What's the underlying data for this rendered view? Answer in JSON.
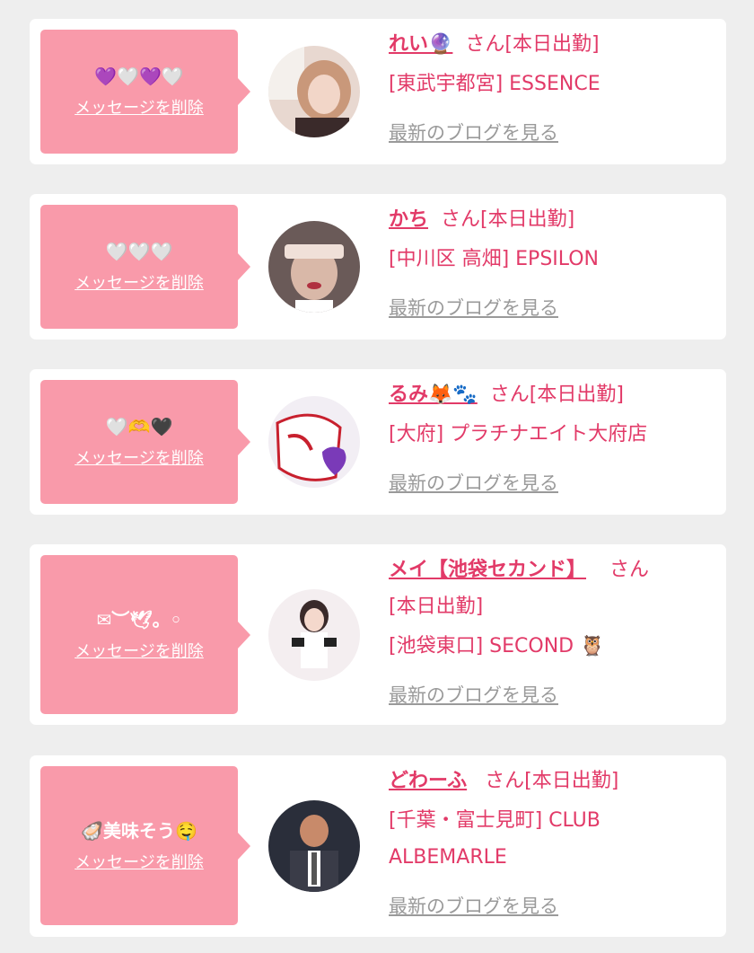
{
  "delete_label": "メッセージを削除",
  "blog_label": "最新のブログを見る",
  "colors": {
    "accent": "#e23a68",
    "bubble": "#f99aaa",
    "background": "#eeeeee"
  },
  "cards": [
    {
      "message": "💜🤍💜🤍",
      "name": "れい🔮",
      "suffix": "さん[本日出勤]",
      "shop": "[東武宇都宮] ESSENCE"
    },
    {
      "message": "🤍🤍🤍",
      "name": "かち",
      "suffix": "さん[本日出勤]",
      "shop": "[中川区 高畑] EPSILON"
    },
    {
      "message": "🤍🫶🖤",
      "name": "るみ🦊🐾",
      "suffix": "さん[本日出勤]",
      "shop": "[大府] プラチナエイト大府店"
    },
    {
      "message": "✉︎︶🕊。◦",
      "name": "メイ【池袋セカンド】",
      "suffix": "さん",
      "status": "[本日出勤]",
      "shop": "[池袋東口] SECOND 🦉"
    },
    {
      "message": "🦪美味そう🤤",
      "name": "どわーふ",
      "suffix": "さん[本日出勤]",
      "shop": "[千葉・富士見町] CLUB",
      "shop2": "ALBEMARLE"
    }
  ]
}
